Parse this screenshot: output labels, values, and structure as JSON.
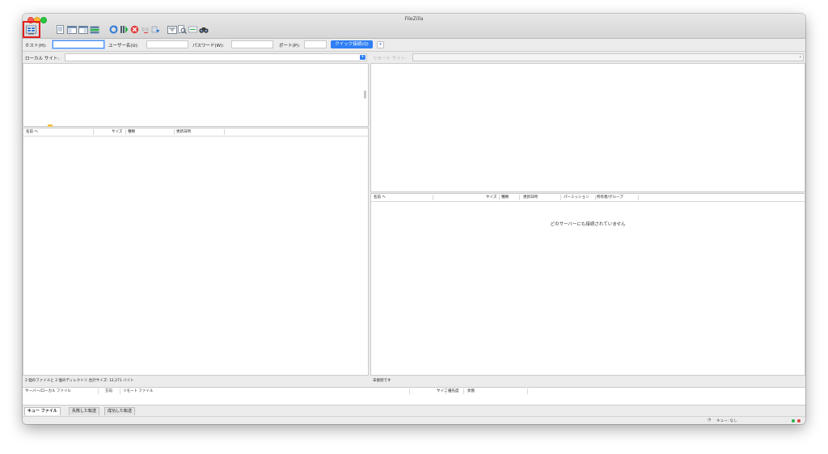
{
  "window": {
    "title": "FileZilla"
  },
  "toolbar": {
    "icons": [
      "site-manager-icon",
      "toggle-message-log-icon",
      "toggle-local-tree-icon",
      "toggle-remote-tree-icon",
      "toggle-queue-icon",
      "refresh-icon",
      "process-queue-icon",
      "cancel-icon",
      "disconnect-icon",
      "reconnect-icon",
      "filter-icon",
      "compare-icon",
      "sync-browse-icon",
      "search-icon"
    ]
  },
  "quickconnect": {
    "host_label": "ホスト(H):",
    "user_label": "ユーザー名(U):",
    "password_label": "パスワード(W):",
    "port_label": "ポート(P):",
    "button_label": "クイック接続(Q)",
    "host_value": "",
    "user_value": "",
    "password_value": "",
    "port_value": ""
  },
  "local": {
    "site_label": "ローカル サイト:",
    "site_value": "",
    "columns": {
      "name": "名前 ヘ",
      "size": "サイズ",
      "type": "種類",
      "modified": "更新日時"
    },
    "status": "2 個のファイルと 2 個のディレクトリ 合計サイズ: 12,271 バイト"
  },
  "remote": {
    "site_label": "リモート サイト:",
    "columns": {
      "name": "名前 ヘ",
      "size": "サイズ",
      "type": "種類",
      "modified": "更新日時",
      "permission": "パーミッション",
      "owner": "所有者/グループ"
    },
    "empty_message": "どのサーバーにも接続されていません",
    "status": "未接続です"
  },
  "queue": {
    "columns": {
      "server_local": "サーバー/ローカル ファイル",
      "direction": "方向",
      "remote_file": "リモート ファイル",
      "size": "サイズ",
      "priority": "優先度",
      "status": "状態"
    },
    "tabs": [
      "キュー ファイル",
      "失敗した転送",
      "成功した転送"
    ],
    "footer_status": "キュー: なし"
  },
  "colors": {
    "accent": "#2f7ff5",
    "highlight": "#e21f1f",
    "led_green": "#2bb24c",
    "led_red": "#e04040"
  }
}
